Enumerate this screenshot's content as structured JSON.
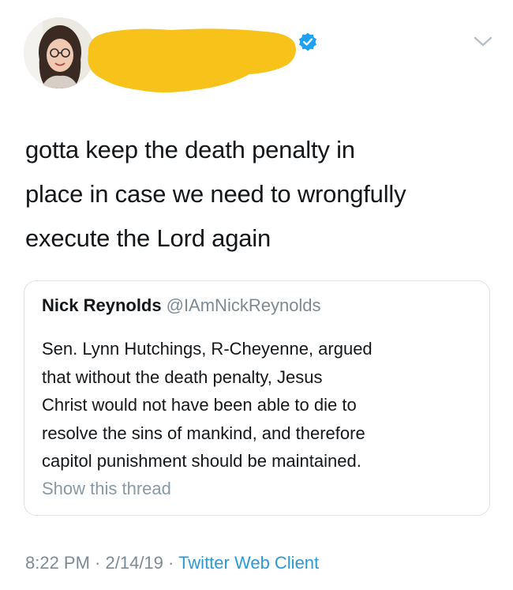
{
  "tweet": {
    "text_lines": [
      "gotta keep the death penalty in",
      "place in case we need to wrongfully",
      "execute the Lord again"
    ],
    "time": "8:22 PM",
    "date": "2/14/19",
    "separator": " · ",
    "client": "Twitter Web Client"
  },
  "quote": {
    "name": "Nick Reynolds",
    "handle": "@IAmNickReynolds",
    "text_lines": [
      "Sen. Lynn Hutchings, R-Cheyenne, argued",
      "that without the death penalty, Jesus",
      "Christ would not have been able to die to",
      "resolve the sins of mankind, and therefore",
      "capitol punishment should be maintained."
    ],
    "show_thread": "Show this thread"
  },
  "icons": {
    "avatar": "avatar",
    "verified": "verified-badge-icon",
    "menu": "chevron-down-icon"
  },
  "colors": {
    "text": "#14171a",
    "secondary": "#7c8a96",
    "link": "#2a9ad9",
    "verified": "#1da1f2",
    "redaction": "#f7c21a"
  }
}
